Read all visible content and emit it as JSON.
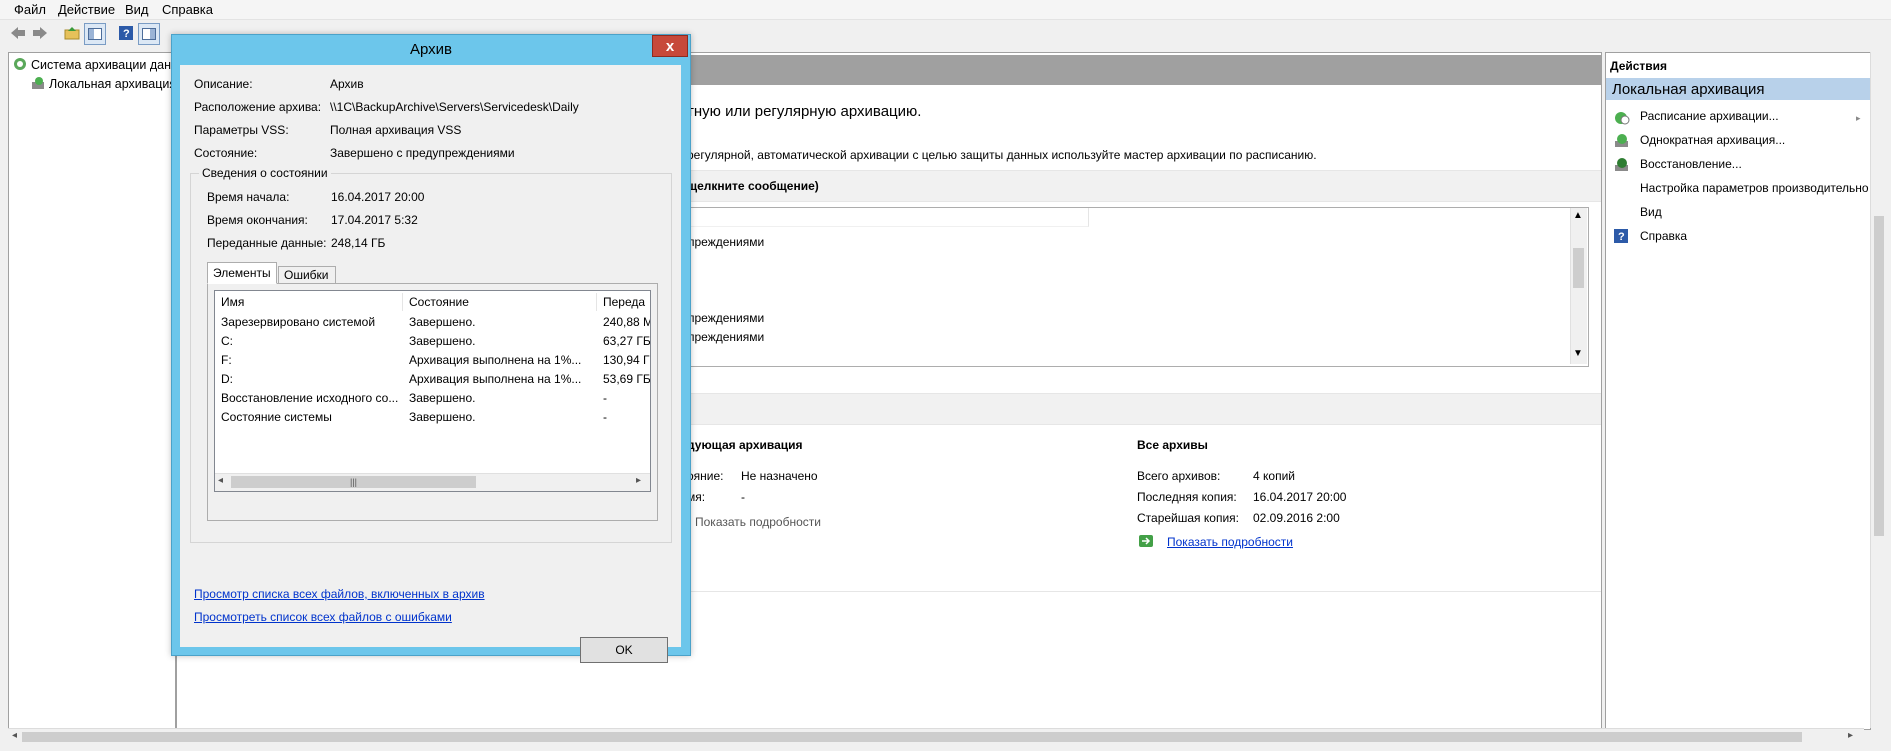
{
  "menu": {
    "items": [
      "Файл",
      "Действие",
      "Вид",
      "Справка"
    ]
  },
  "tree": {
    "root_label": "Система архивации данн",
    "child_label": "Локальная архивация"
  },
  "center": {
    "intro_heading": "тную или регулярную архивацию.",
    "intro_text": "регулярной, автоматической архивации с целью защиты данных используйте мастер архивации по расписанию.",
    "messages_header": "щелкните сообщение)",
    "messages": [
      "преждениями",
      "преждениями",
      "преждениями"
    ],
    "next_backup": {
      "title": "дующая архивация",
      "status_label": "ояние:",
      "status_value": "Не назначено",
      "info_label": "мя:",
      "info_value": "-",
      "details_link": "Показать подробности"
    },
    "all_archives": {
      "title": "Все архивы",
      "total_label": "Всего архивов:",
      "total_value": "4 копий",
      "last_label": "Последняя копия:",
      "last_value": "16.04.2017 20:00",
      "oldest_label": "Старейшая копия:",
      "oldest_value": "02.09.2016 2:00",
      "details_link": "Показать подробности"
    }
  },
  "actions": {
    "header": "Действия",
    "section": "Локальная архивация",
    "items": [
      "Расписание архивации...",
      "Однократная архивация...",
      "Восстановление...",
      "Настройка параметров производительно",
      "Вид",
      "Справка"
    ]
  },
  "dialog": {
    "title": "Архив",
    "close": "x",
    "fields": {
      "description_label": "Описание:",
      "description_value": "Архив",
      "location_label": "Расположение архива:",
      "location_value": "\\\\1C\\BackupArchive\\Servers\\Servicedesk\\Daily",
      "vss_label": "Параметры VSS:",
      "vss_value": "Полная архивация VSS",
      "state_label": "Состояние:",
      "state_value": "Завершено с предупреждениями"
    },
    "group_title": "Сведения о состоянии",
    "details": {
      "start_label": "Время начала:",
      "start_value": "16.04.2017 20:00",
      "end_label": "Время окончания:",
      "end_value": "17.04.2017 5:32",
      "transferred_label": "Переданные данные:",
      "transferred_value": "248,14 ГБ"
    },
    "tabs": [
      "Элементы",
      "Ошибки"
    ],
    "columns": [
      "Имя",
      "Состояние",
      "Переда"
    ],
    "rows": [
      {
        "name": "Зарезервировано системой",
        "state": "Завершено.",
        "size": "240,88 М"
      },
      {
        "name": "C:",
        "state": "Завершено.",
        "size": "63,27 ГБ"
      },
      {
        "name": "F:",
        "state": "Архивация выполнена на 1%...",
        "size": "130,94 Г"
      },
      {
        "name": "D:",
        "state": "Архивация выполнена на 1%...",
        "size": "53,69 ГБ"
      },
      {
        "name": "Восстановление исходного со...",
        "state": "Завершено.",
        "size": "-"
      },
      {
        "name": "Состояние системы",
        "state": "Завершено.",
        "size": "-"
      }
    ],
    "link_all_files": "Просмотр списка всех файлов, включенных в архив",
    "link_error_files": "Просмотреть список всех файлов с ошибками",
    "ok": "OK"
  }
}
